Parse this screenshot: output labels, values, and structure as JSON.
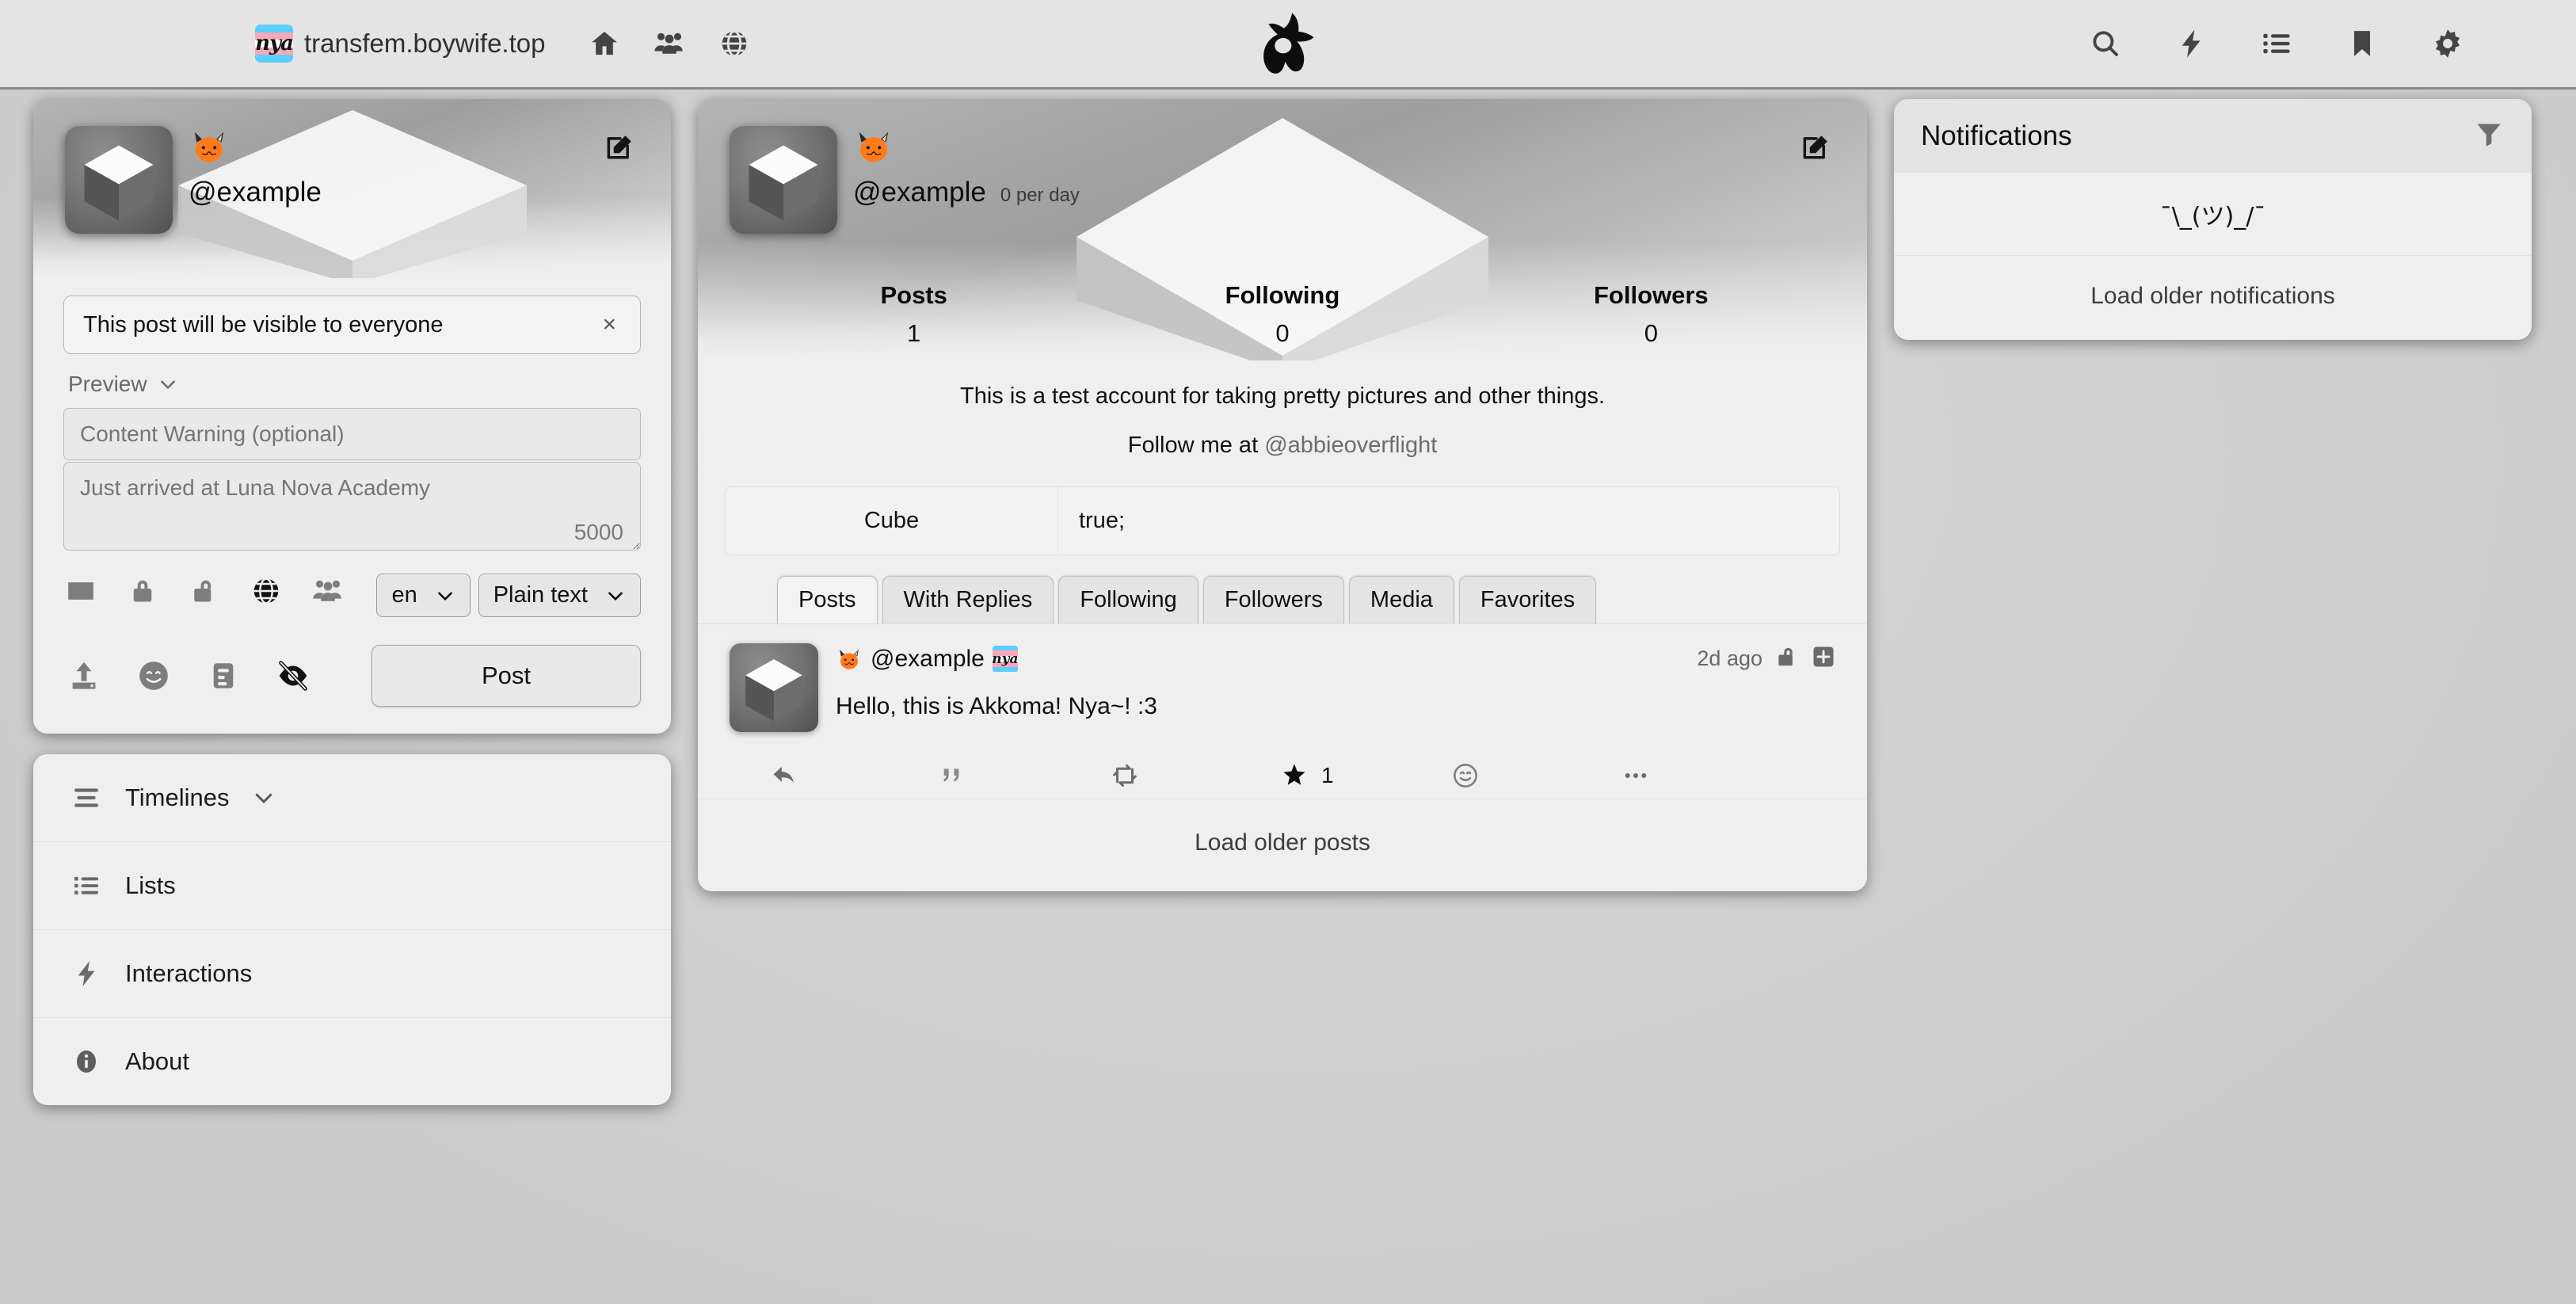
{
  "topbar": {
    "site_name": "transfem.boywife.top",
    "site_emoji_alt": "nya",
    "nav_left": [
      {
        "name": "home-icon",
        "label": "Home"
      },
      {
        "name": "group-icon",
        "label": "Local"
      },
      {
        "name": "globe-icon",
        "label": "Federated"
      }
    ],
    "logo_name": "akkoma-logo",
    "nav_right": [
      {
        "name": "search-icon",
        "label": "Search"
      },
      {
        "name": "lightning-icon",
        "label": "Interactions"
      },
      {
        "name": "list-icon",
        "label": "Lists"
      },
      {
        "name": "bookmark-icon",
        "label": "Bookmarks"
      },
      {
        "name": "gear-icon",
        "label": "Settings"
      }
    ]
  },
  "composer": {
    "handle": "@example",
    "scope_notice": "This post will be visible to everyone",
    "close_label": "×",
    "preview_label": "Preview",
    "cw_placeholder": "Content Warning (optional)",
    "body_placeholder": "Just arrived at Luna Nova Academy",
    "char_count": "5000",
    "visibility_icons": [
      {
        "name": "envelope-icon",
        "label": "Direct"
      },
      {
        "name": "lock-icon",
        "label": "Private"
      },
      {
        "name": "unlock-icon",
        "label": "Unlisted"
      },
      {
        "name": "globe-icon",
        "label": "Public"
      },
      {
        "name": "group-icon",
        "label": "Local"
      }
    ],
    "language_value": "en",
    "format_value": "Plain text",
    "tools": [
      {
        "name": "upload-icon",
        "label": "Attach media"
      },
      {
        "name": "emoji-icon",
        "label": "Emoji"
      },
      {
        "name": "poll-icon",
        "label": "Poll"
      },
      {
        "name": "eye-off-icon",
        "label": "Content warning toggle"
      }
    ],
    "post_label": "Post"
  },
  "sidebar": {
    "items": [
      {
        "label": "Timelines",
        "icon": "hamburger-icon",
        "has_chevron": true
      },
      {
        "label": "Lists",
        "icon": "list-icon",
        "has_chevron": false
      },
      {
        "label": "Interactions",
        "icon": "lightning-icon",
        "has_chevron": false
      },
      {
        "label": "About",
        "icon": "info-icon",
        "has_chevron": false
      }
    ]
  },
  "profile": {
    "handle": "@example",
    "per_day": "0 per day",
    "stats": [
      {
        "label": "Posts",
        "value": "1"
      },
      {
        "label": "Following",
        "value": "0"
      },
      {
        "label": "Followers",
        "value": "0"
      }
    ],
    "bio_line1": "This is a test account for taking pretty pictures and other things.",
    "bio_line2_prefix": "Follow me at ",
    "bio_line2_mention": "@abbieoverflight",
    "fields": [
      {
        "name": "Cube",
        "value": "true;"
      }
    ],
    "tabs": [
      {
        "label": "Posts",
        "active": true
      },
      {
        "label": "With Replies",
        "active": false
      },
      {
        "label": "Following",
        "active": false
      },
      {
        "label": "Followers",
        "active": false
      },
      {
        "label": "Media",
        "active": false
      },
      {
        "label": "Favorites",
        "active": false
      }
    ],
    "load_more": "Load older posts"
  },
  "post": {
    "handle": "@example",
    "time": "2d ago",
    "visibility_icon": "unlock-icon",
    "expand_icon": "expand-icon",
    "text": "Hello, this is Akkoma! Nya~! :3",
    "actions": [
      {
        "name": "reply-icon",
        "label": "Reply",
        "count": ""
      },
      {
        "name": "quote-icon",
        "label": "Quote",
        "count": ""
      },
      {
        "name": "repeat-icon",
        "label": "Repeat",
        "count": ""
      },
      {
        "name": "star-icon",
        "label": "Favorite",
        "count": "1"
      },
      {
        "name": "emoji-react-icon",
        "label": "React",
        "count": ""
      },
      {
        "name": "more-icon",
        "label": "More",
        "count": ""
      }
    ]
  },
  "notifications": {
    "title": "Notifications",
    "filter_icon": "funnel-icon",
    "empty_text": "¯\\_(ツ)_/¯",
    "load_more": "Load older notifications"
  },
  "colors": {
    "page_bg": "#d2d2d2",
    "panel_bg": "#efefef",
    "topbar_bg": "#e4e4e4",
    "flag_blue": "#5bcefa",
    "flag_pink": "#f5a9b8",
    "flag_white": "#ffffff",
    "fox_orange": "#ff7a18",
    "text": "#111111",
    "muted": "#6d6d6d"
  }
}
